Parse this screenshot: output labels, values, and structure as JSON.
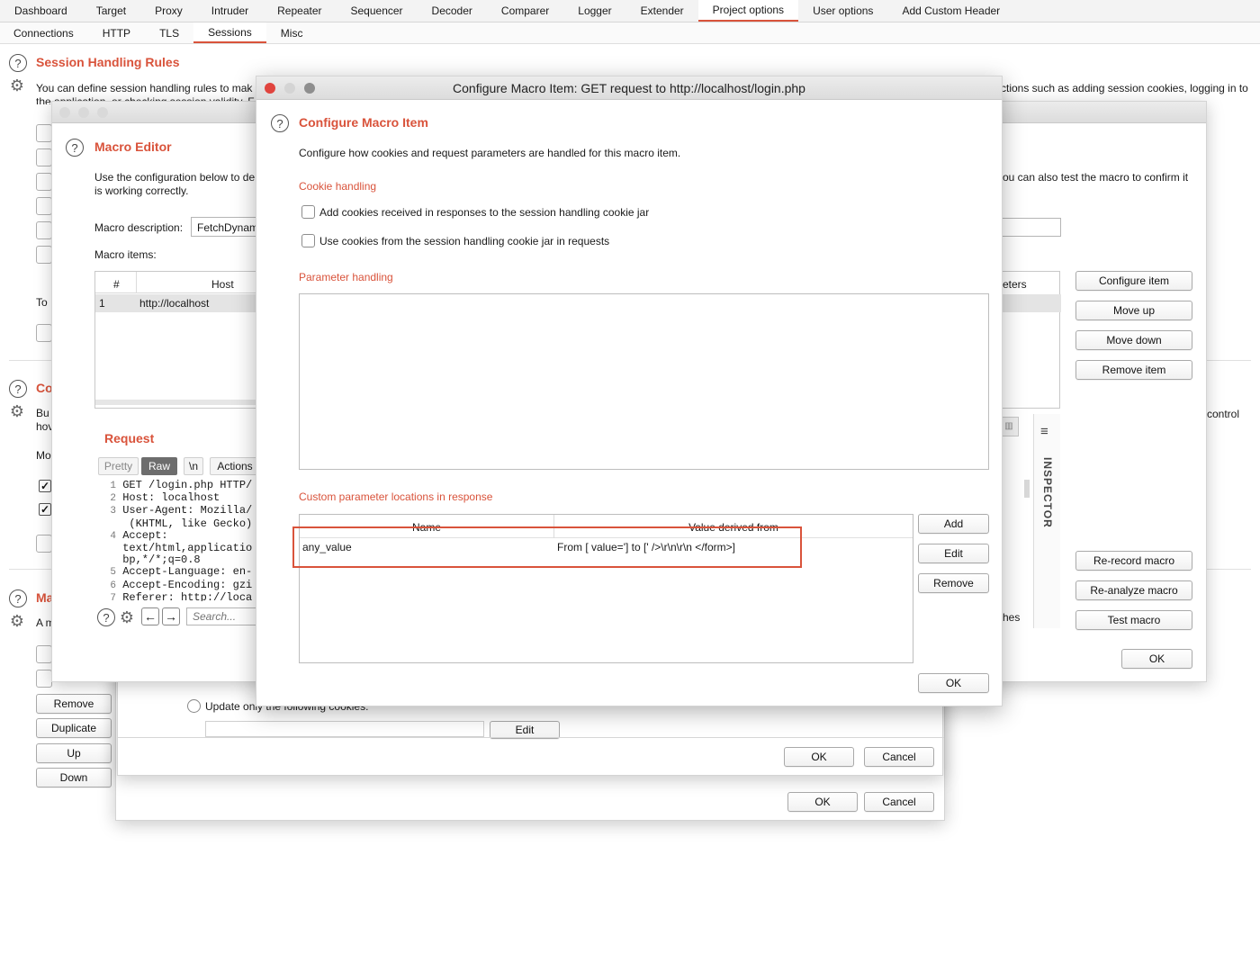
{
  "top_tabs": [
    "Dashboard",
    "Target",
    "Proxy",
    "Intruder",
    "Repeater",
    "Sequencer",
    "Decoder",
    "Comparer",
    "Logger",
    "Extender",
    "Project options",
    "User options",
    "Add Custom Header"
  ],
  "active_top_tab": "Project options",
  "sub_tabs": [
    "Connections",
    "HTTP",
    "TLS",
    "Sessions",
    "Misc"
  ],
  "active_sub_tab": "Sessions",
  "background": {
    "session_title": "Session Handling Rules",
    "session_desc_line1": "You can define session handling rules to mak",
    "session_desc_line2": "the application, or checking session validity. F",
    "session_desc_right": "ctions such as adding session cookies, logging in to",
    "to_label": "To",
    "cookie_jar_title": "Co",
    "cookie_jar_line1": "Bu",
    "cookie_jar_line2": "hov",
    "cookie_jar_mo": "Mo",
    "control_text": "control",
    "macros_title": "Ma",
    "macros_desc": "A m",
    "buttons": [
      "Remove",
      "Duplicate",
      "Up",
      "Down"
    ],
    "update_only_label": "Update only the following cookies:",
    "edit_label": "Edit",
    "ok_label": "OK",
    "cancel_label": "Cancel"
  },
  "macro_editor": {
    "title": "Macro Editor",
    "desc_line1": "Use the configuration below to de",
    "desc_line2": "is working correctly.",
    "desc_right": "ou can also test the macro to confirm it",
    "description_label": "Macro description:",
    "description_value": "FetchDynam",
    "items_label": "Macro items:",
    "col_num": "#",
    "col_host": "Host",
    "col_params_partial": "eters",
    "row_num": "1",
    "row_host": "http://localhost",
    "request_title": "Request",
    "view_tabs": [
      "Pretty",
      "Raw",
      "\\n",
      "Actions"
    ],
    "request_lines": [
      {
        "n": "1",
        "t": "GET /login.php HTTP/"
      },
      {
        "n": "2",
        "t": "Host: localhost"
      },
      {
        "n": "3",
        "t": "User-Agent: Mozilla/"
      },
      {
        "n": "",
        "t": " (KHTML, like Gecko)"
      },
      {
        "n": "4",
        "t": "Accept:"
      },
      {
        "n": "",
        "t": "text/html,applicatio"
      },
      {
        "n": "",
        "t": "bp,*/*;q=0.8"
      },
      {
        "n": "5",
        "t": "Accept-Language: en-"
      },
      {
        "n": "6",
        "t": "Accept-Encoding: gzi"
      },
      {
        "n": "7",
        "t": "Referer: http://loca"
      }
    ],
    "search_placeholder": "Search...",
    "inspector_label": "INSPECTOR",
    "hes_partial": "hes",
    "right_buttons": [
      "Configure item",
      "Move up",
      "Move down",
      "Remove item"
    ],
    "bottom_buttons": [
      "Re-record macro",
      "Re-analyze macro",
      "Test macro"
    ],
    "ok_label": "OK"
  },
  "configure_dialog": {
    "window_title": "Configure Macro Item: GET request to http://localhost/login.php",
    "title": "Configure Macro Item",
    "description": "Configure how cookies and request parameters are handled for this macro item.",
    "cookie_section": "Cookie handling",
    "cookie_option1": "Add cookies received in responses to the session handling cookie jar",
    "cookie_option2": "Use cookies from the session handling cookie jar in requests",
    "param_section": "Parameter handling",
    "custom_section": "Custom parameter locations in response",
    "col_name": "Name",
    "col_value": "Value derived from",
    "rows": [
      {
        "name": "any_value",
        "value": "From [ value='] to [' />\\r\\n\\r\\n </form>]"
      }
    ],
    "add_label": "Add",
    "edit_label": "Edit",
    "remove_label": "Remove",
    "ok_label": "OK",
    "highlight_color": "#d9533b"
  }
}
